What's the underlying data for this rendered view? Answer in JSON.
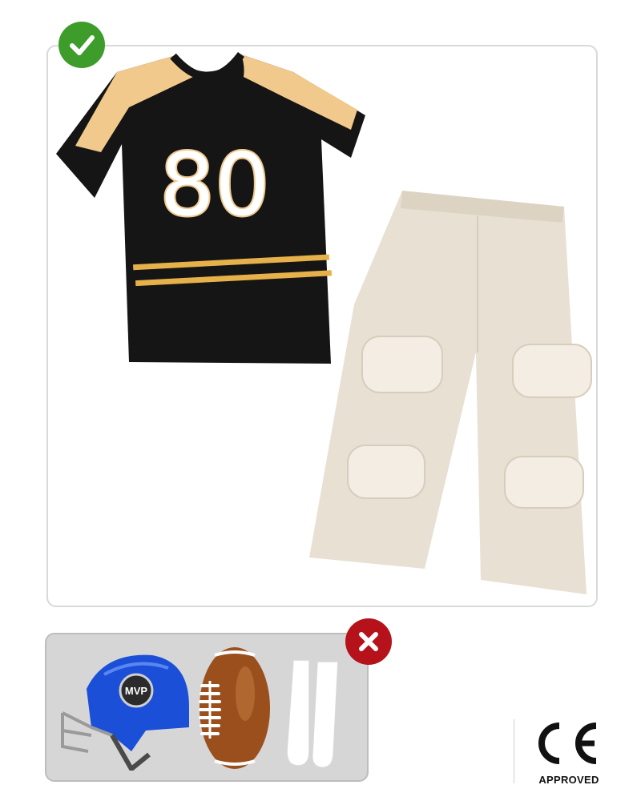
{
  "included": {
    "status_icon": "check-icon",
    "status_color": "#3d9c2a",
    "jersey": {
      "number": "80",
      "body_color": "#151515",
      "accent_color": "#f1c98d"
    },
    "pants": {
      "color": "#e8e0d3"
    }
  },
  "excluded": {
    "status_icon": "cross-icon",
    "status_color": "#b5121b",
    "items": {
      "helmet": {
        "label": "MVP",
        "color": "#1b4fd8"
      },
      "football": {
        "color": "#9a4f1d"
      },
      "socks": {
        "color": "#ffffff"
      }
    }
  },
  "certification": {
    "mark": "CE",
    "caption": "APPROVED"
  }
}
